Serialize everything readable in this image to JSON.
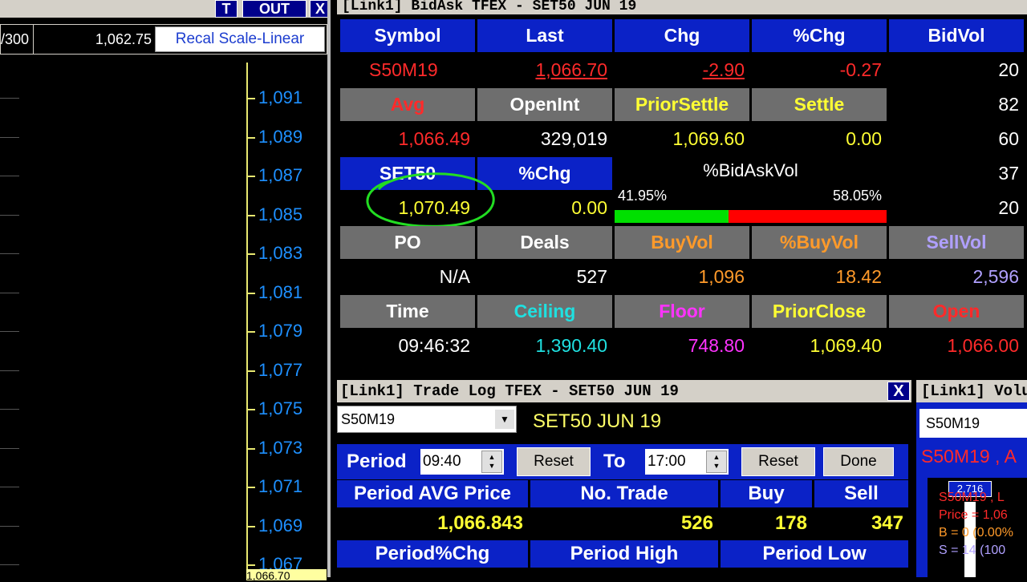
{
  "left_chart": {
    "top_buttons": [
      "T",
      "OUT",
      "X"
    ],
    "info_left": "/300",
    "info_price": "1,062.75",
    "recal_label": "Recal Scale-Linear",
    "y_ticks": [
      "1,091",
      "1,089",
      "1,087",
      "1,085",
      "1,083",
      "1,081",
      "1,079",
      "1,077",
      "1,075",
      "1,073",
      "1,071",
      "1,069",
      "1,067"
    ],
    "price_tag": "1,066.70"
  },
  "bidask": {
    "title": "[Link1] BidAsk TFEX - SET50 JUN 19",
    "headers_row1": [
      "Symbol",
      "Last",
      "Chg",
      "%Chg",
      "BidVol"
    ],
    "values_row1": [
      "S50M19",
      "1,066.70",
      "-2.90",
      "-0.27",
      "20"
    ],
    "headers_row2": [
      "Avg",
      "OpenInt",
      "PriorSettle",
      "Settle"
    ],
    "bidvol_2": "82",
    "values_row2": [
      "1,066.49",
      "329,019",
      "1,069.60",
      "0.00"
    ],
    "bidvol_3": "60",
    "headers_row3": [
      "SET50",
      "%Chg"
    ],
    "bidaskvol_label": "%BidAskVol",
    "bid_pct_text": "41.95%",
    "ask_pct_text": "58.05%",
    "bid_fraction": 0.4195,
    "bidvol_4": "37",
    "values_row3": [
      "1,070.49",
      "0.00"
    ],
    "bidvol_5": "20",
    "headers_row4": [
      "PO",
      "Deals",
      "BuyVol",
      "%BuyVol",
      "SellVol"
    ],
    "values_row4": [
      "N/A",
      "527",
      "1,096",
      "18.42",
      "2,596"
    ],
    "headers_row5": [
      "Time",
      "Ceiling",
      "Floor",
      "PriorClose",
      "Open"
    ],
    "values_row5": [
      "09:46:32",
      "1,390.40",
      "748.80",
      "1,069.40",
      "1,066.00"
    ]
  },
  "trade_log": {
    "title": "[Link1] Trade Log TFEX - SET50 JUN 19",
    "close": "X",
    "symbol_combo": "S50M19",
    "symbol_name": "SET50 JUN 19",
    "period_label": "Period",
    "from_time": "09:40",
    "to_label": "To",
    "to_time": "17:00",
    "reset_label": "Reset",
    "done_label": "Done",
    "headers": [
      "Period AVG Price",
      "No. Trade",
      "Buy",
      "Sell"
    ],
    "values": [
      "1,066.843",
      "526",
      "178",
      "347"
    ],
    "headers2": [
      "Period%Chg",
      "Period High",
      "Period Low"
    ]
  },
  "volume": {
    "title": "[Link1] Volu",
    "symbol_combo": "S50M19",
    "symbol_text": "S50M19 , A",
    "chart_label_top": "2,716",
    "chart_lines": [
      "S50M19 , L",
      "Price = 1,06",
      "B = 0 (0.00%",
      "S = 14 (100"
    ]
  }
}
